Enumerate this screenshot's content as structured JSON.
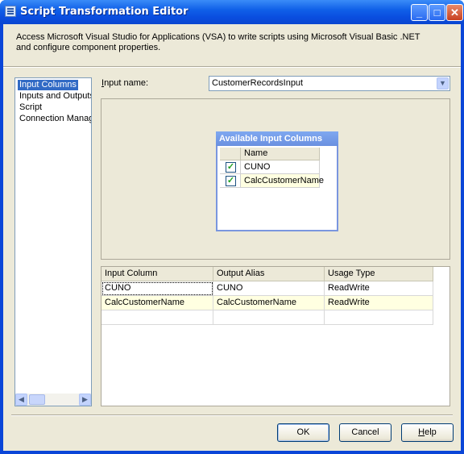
{
  "window": {
    "title": "Script Transformation Editor",
    "minimize_glyph": "_",
    "maximize_glyph": "□",
    "close_glyph": "✕"
  },
  "description": "Access Microsoft Visual Studio for Applications (VSA) to write scripts using Microsoft Visual Basic .NET and configure component properties.",
  "nav": {
    "items": [
      {
        "label": "Input Columns",
        "selected": true
      },
      {
        "label": "Inputs and Outputs",
        "selected": false
      },
      {
        "label": "Script",
        "selected": false
      },
      {
        "label": "Connection Managers",
        "selected": false
      }
    ]
  },
  "input": {
    "label_prefix": "I",
    "label_rest": "nput name:",
    "value": "CustomerRecordsInput"
  },
  "available_columns": {
    "title": "Available Input Columns",
    "header": "Name",
    "rows": [
      {
        "name": "CUNO",
        "checked": true
      },
      {
        "name": "CalcCustomerName",
        "checked": true
      }
    ]
  },
  "columns_grid": {
    "headers": [
      "Input Column",
      "Output Alias",
      "Usage Type"
    ],
    "rows": [
      [
        "CUNO",
        "CUNO",
        "ReadWrite"
      ],
      [
        "CalcCustomerName",
        "CalcCustomerName",
        "ReadWrite"
      ]
    ]
  },
  "buttons": {
    "ok": "OK",
    "cancel": "Cancel",
    "help_prefix": "H",
    "help_rest": "elp"
  },
  "colors": {
    "title_bar": "#0a46d8",
    "selection": "#316ac5",
    "alt_row": "#ffffe1",
    "dialog_bg": "#ece9d8"
  }
}
